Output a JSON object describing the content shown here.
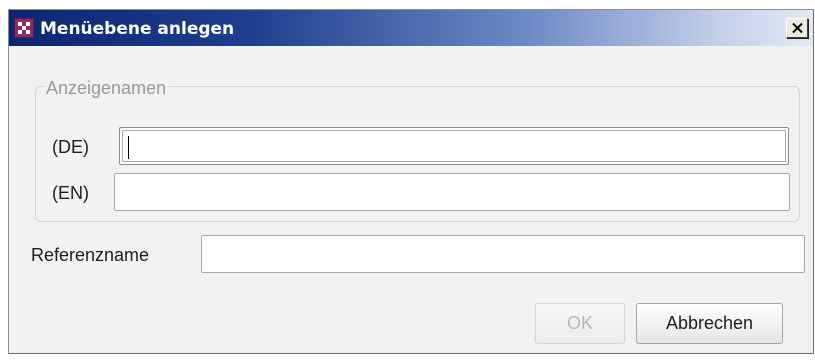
{
  "dialog": {
    "title": "Menüebene anlegen",
    "close_label": "X"
  },
  "display_names": {
    "legend": "Anzeigenamen",
    "de_label": "(DE)",
    "de_value": "",
    "en_label": "(EN)",
    "en_value": ""
  },
  "reference": {
    "label": "Referenzname",
    "value": ""
  },
  "buttons": {
    "ok_label": "OK",
    "ok_enabled": false,
    "cancel_label": "Abbrechen"
  },
  "colors": {
    "titlebar_start": "#0b2572",
    "titlebar_end": "#e4e9f5",
    "app_icon": "#8e2a6b",
    "dialog_background": "#f2f2f2",
    "disabled_text": "#b6b6b6"
  },
  "icons": {
    "app": "app-logo-icon",
    "close": "close-icon"
  }
}
